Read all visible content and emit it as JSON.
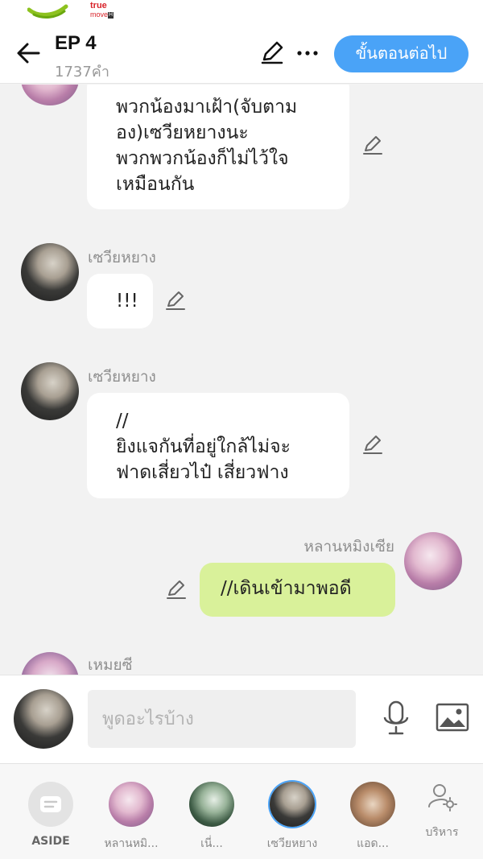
{
  "statusbar": {
    "carrier_brand": "true",
    "carrier_sub": "move",
    "carrier_h": "H"
  },
  "header": {
    "title": "EP 4",
    "word_count": "1737คำ",
    "next_button": "ขั้นตอนต่อไป",
    "accent_color": "#4aa3f7"
  },
  "messages": [
    {
      "type": "received",
      "sender": "",
      "lines": [
        "พวกน้องมาเฝ้า(จับตาม",
        "อง)เซวียหยางนะ",
        "พวกพวกน้องก็ไม่ไว้ใจ",
        "เหมือนกัน"
      ]
    },
    {
      "type": "received",
      "sender": "เซวียหยาง",
      "lines": [
        "!!!"
      ]
    },
    {
      "type": "received",
      "sender": "เซวียหยาง",
      "lines": [
        "//",
        "ยิงแจกันที่อยู่ใกล้ไม่จะ",
        "ฟาดเสี่ยวไป๋ เสี่ยวฟาง"
      ]
    },
    {
      "type": "sent",
      "sender": "หลานหมิงเซีย",
      "lines": [
        "//เดินเข้ามาพอดี"
      ]
    },
    {
      "type": "received",
      "sender": "เหมยซี",
      "lines": []
    }
  ],
  "input": {
    "placeholder": "พูดอะไรบ้าง"
  },
  "tabs": [
    {
      "label": "ASIDE",
      "icon": "aside-chat-icon"
    },
    {
      "label": "หลานหมิ...",
      "icon": "character-avatar"
    },
    {
      "label": "เนี่...",
      "icon": "character-avatar"
    },
    {
      "label": "เซวียหยาง",
      "icon": "character-avatar"
    },
    {
      "label": "แอด...",
      "icon": "character-avatar"
    },
    {
      "label": "บริหาร",
      "icon": "manage-user-icon"
    }
  ],
  "colors": {
    "sent_bubble": "#d9f19a",
    "received_bubble": "#ffffff",
    "chat_background": "#f2f2f2"
  }
}
